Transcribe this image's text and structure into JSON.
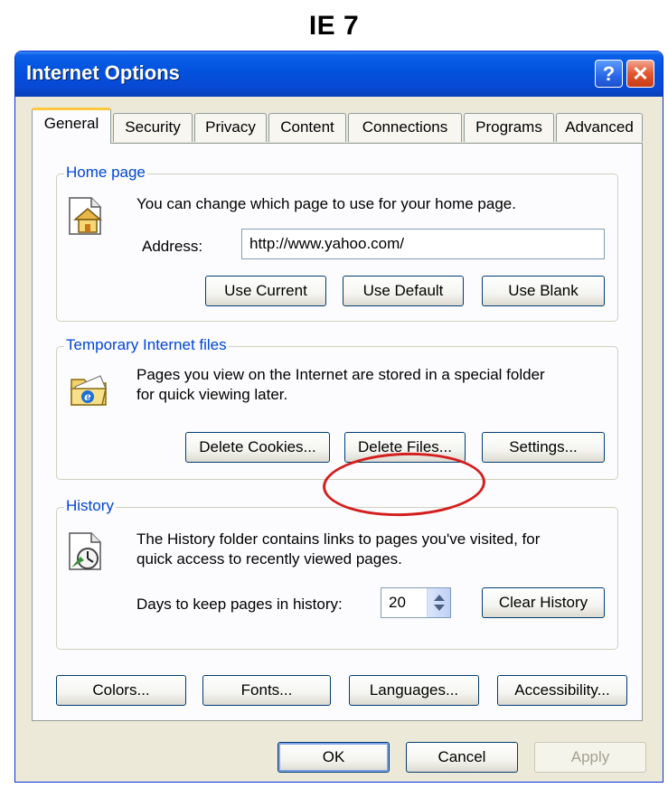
{
  "caption": "IE 7",
  "window": {
    "title": "Internet Options",
    "help_glyph": "?",
    "close_glyph": "✕"
  },
  "tabs": [
    {
      "label": "General",
      "active": true
    },
    {
      "label": "Security"
    },
    {
      "label": "Privacy"
    },
    {
      "label": "Content"
    },
    {
      "label": "Connections"
    },
    {
      "label": "Programs"
    },
    {
      "label": "Advanced"
    }
  ],
  "home_page": {
    "group_label": "Home page",
    "icon": "house-document-icon",
    "description": "You can change which page to use for your home page.",
    "address_label": "Address:",
    "address_value": "http://www.yahoo.com/",
    "use_current": "Use Current",
    "use_default": "Use Default",
    "use_blank": "Use Blank"
  },
  "temp_files": {
    "group_label": "Temporary Internet files",
    "icon": "ie-folder-icon",
    "description_line1": "Pages you view on the Internet are stored in a special folder",
    "description_line2": "for quick viewing later.",
    "delete_cookies": "Delete Cookies...",
    "delete_files": "Delete Files...",
    "settings": "Settings..."
  },
  "history": {
    "group_label": "History",
    "icon": "history-clock-icon",
    "description_line1": "The History folder contains links to pages you've visited, for",
    "description_line2": "quick access to recently viewed pages.",
    "days_label": "Days to keep pages in history:",
    "days_value": "20",
    "clear_history": "Clear History"
  },
  "bottom_buttons": {
    "colors": "Colors...",
    "fonts": "Fonts...",
    "languages": "Languages...",
    "accessibility": "Accessibility..."
  },
  "dialog_buttons": {
    "ok": "OK",
    "cancel": "Cancel",
    "apply": "Apply"
  },
  "colors": {
    "titlebar": "#0152dd",
    "group_label": "#0046d5",
    "highlight": "#d41e1e",
    "active_tab": "#ffc83c"
  }
}
